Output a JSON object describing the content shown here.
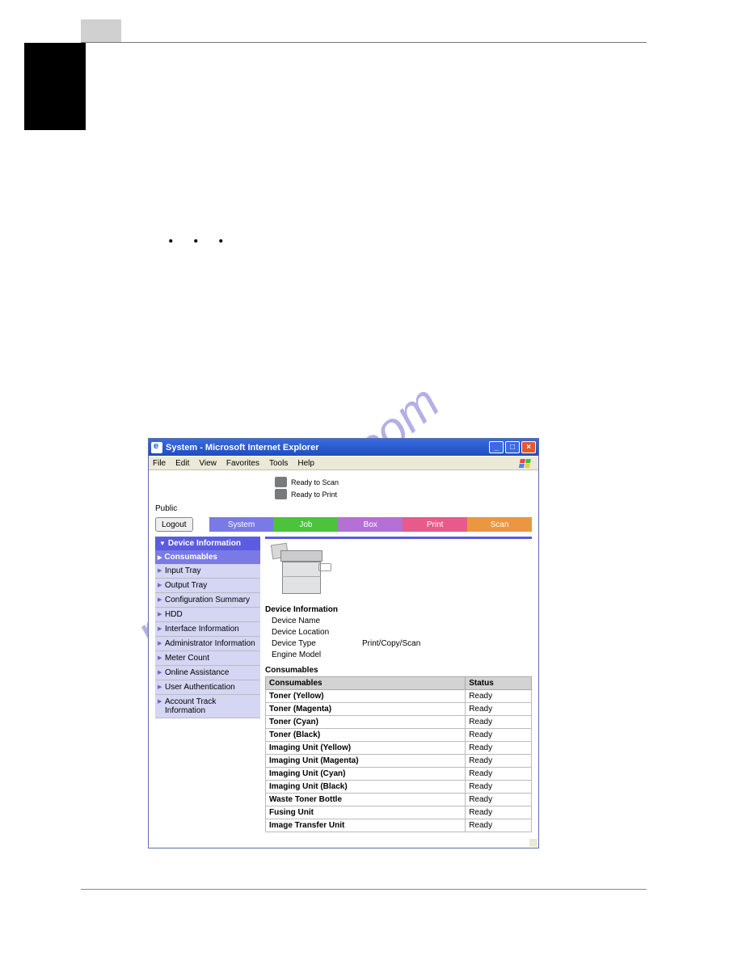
{
  "dots": ". . .",
  "window": {
    "title": "System - Microsoft Internet Explorer",
    "menus": [
      "File",
      "Edit",
      "View",
      "Favorites",
      "Tools",
      "Help"
    ],
    "status1": "Ready to Scan",
    "status2": "Ready to Print",
    "public": "Public"
  },
  "buttons": {
    "logout": "Logout"
  },
  "tabs": {
    "system": "System",
    "job": "Job",
    "box": "Box",
    "print": "Print",
    "scan": "Scan"
  },
  "sidebar": {
    "header": "Device Information",
    "active": "Consumables",
    "items": {
      "i0": "Input Tray",
      "i1": "Output Tray",
      "i2": "Configuration Summary",
      "i3": "HDD",
      "i4": "Interface Information",
      "i5": "Administrator Information",
      "i6": "Meter Count",
      "i7": "Online Assistance",
      "i8": "User Authentication",
      "i9": "Account Track Information"
    }
  },
  "device": {
    "section": "Device Information",
    "rows": {
      "name_l": "Device Name",
      "name_v": "",
      "loc_l": "Device Location",
      "loc_v": "",
      "type_l": "Device Type",
      "type_v": "Print/Copy/Scan",
      "eng_l": "Engine Model",
      "eng_v": ""
    }
  },
  "consumables": {
    "section": "Consumables",
    "col1": "Consumables",
    "col2": "Status",
    "rows": [
      {
        "name": "Toner (Yellow)",
        "status": "Ready"
      },
      {
        "name": "Toner (Magenta)",
        "status": "Ready"
      },
      {
        "name": "Toner (Cyan)",
        "status": "Ready"
      },
      {
        "name": "Toner (Black)",
        "status": "Ready"
      },
      {
        "name": "Imaging Unit (Yellow)",
        "status": "Ready"
      },
      {
        "name": "Imaging Unit (Magenta)",
        "status": "Ready"
      },
      {
        "name": "Imaging Unit (Cyan)",
        "status": "Ready"
      },
      {
        "name": "Imaging Unit (Black)",
        "status": "Ready"
      },
      {
        "name": "Waste Toner Bottle",
        "status": "Ready"
      },
      {
        "name": "Fusing Unit",
        "status": "Ready"
      },
      {
        "name": "Image Transfer Unit",
        "status": "Ready"
      }
    ]
  }
}
